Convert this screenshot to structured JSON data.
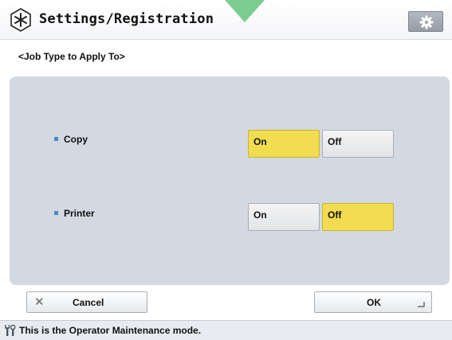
{
  "header": {
    "title": "Settings/Registration",
    "title_icon": "settings-asterisk-icon",
    "gear_icon": "gear-icon"
  },
  "subtitle": "<Job Type to Apply To>",
  "rows": [
    {
      "label": "Copy",
      "on_label": "On",
      "off_label": "Off",
      "selected": "On"
    },
    {
      "label": "Printer",
      "on_label": "On",
      "off_label": "Off",
      "selected": "Off"
    }
  ],
  "footer": {
    "cancel_label": "Cancel",
    "ok_label": "OK"
  },
  "status": {
    "text": "This is the Operator Maintenance mode.",
    "icon": "wrench-icon"
  },
  "colors": {
    "selected": "#f2dc4f",
    "panel": "#d3d9e3",
    "accent_green": "#7ccc8f"
  }
}
